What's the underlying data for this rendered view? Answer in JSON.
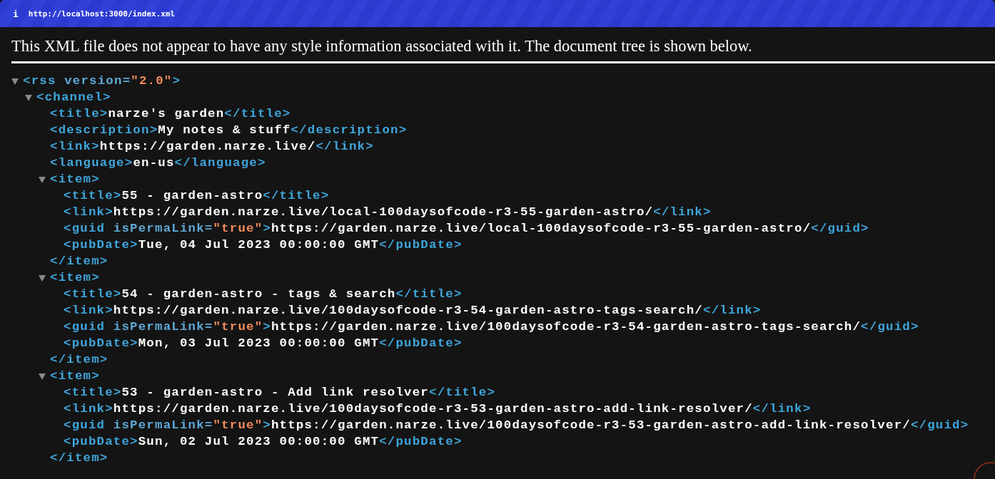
{
  "address_bar": {
    "info_glyph": "i",
    "url": "http://localhost:3000/index.xml"
  },
  "notice": "This XML file does not appear to have any style information associated with it. The document tree is shown below.",
  "tree": [
    {
      "kind": "element",
      "expanded": true,
      "open": [
        {
          "kind": "tag",
          "text": "<rss "
        },
        {
          "kind": "attr",
          "text": "version="
        },
        {
          "kind": "value",
          "text": "\"2.0\""
        },
        {
          "kind": "tag",
          "text": ">"
        }
      ],
      "children": [
        {
          "kind": "element",
          "expanded": true,
          "open": [
            {
              "kind": "tag",
              "text": "<channel>"
            }
          ],
          "children": [
            {
              "kind": "line",
              "tokens": [
                {
                  "kind": "tag",
                  "text": "<title>"
                },
                {
                  "kind": "text",
                  "text": "narze's garden"
                },
                {
                  "kind": "tag",
                  "text": "</title>"
                }
              ]
            },
            {
              "kind": "line",
              "tokens": [
                {
                  "kind": "tag",
                  "text": "<description>"
                },
                {
                  "kind": "text",
                  "text": "My notes & stuff"
                },
                {
                  "kind": "tag",
                  "text": "</description>"
                }
              ]
            },
            {
              "kind": "line",
              "tokens": [
                {
                  "kind": "tag",
                  "text": "<link>"
                },
                {
                  "kind": "text",
                  "text": "https://garden.narze.live/"
                },
                {
                  "kind": "tag",
                  "text": "</link>"
                }
              ]
            },
            {
              "kind": "line",
              "tokens": [
                {
                  "kind": "tag",
                  "text": "<language>"
                },
                {
                  "kind": "text",
                  "text": "en-us"
                },
                {
                  "kind": "tag",
                  "text": "</language>"
                }
              ]
            },
            {
              "kind": "element",
              "expanded": true,
              "open": [
                {
                  "kind": "tag",
                  "text": "<item>"
                }
              ],
              "children": [
                {
                  "kind": "line",
                  "tokens": [
                    {
                      "kind": "tag",
                      "text": "<title>"
                    },
                    {
                      "kind": "text",
                      "text": "55 - garden-astro"
                    },
                    {
                      "kind": "tag",
                      "text": "</title>"
                    }
                  ]
                },
                {
                  "kind": "line",
                  "tokens": [
                    {
                      "kind": "tag",
                      "text": "<link>"
                    },
                    {
                      "kind": "text",
                      "text": "https://garden.narze.live/local-100daysofcode-r3-55-garden-astro/"
                    },
                    {
                      "kind": "tag",
                      "text": "</link>"
                    }
                  ]
                },
                {
                  "kind": "line",
                  "tokens": [
                    {
                      "kind": "tag",
                      "text": "<guid "
                    },
                    {
                      "kind": "attr",
                      "text": "isPermaLink="
                    },
                    {
                      "kind": "value",
                      "text": "\"true\""
                    },
                    {
                      "kind": "tag",
                      "text": ">"
                    },
                    {
                      "kind": "text",
                      "text": "https://garden.narze.live/local-100daysofcode-r3-55-garden-astro/"
                    },
                    {
                      "kind": "tag",
                      "text": "</guid>"
                    }
                  ]
                },
                {
                  "kind": "line",
                  "tokens": [
                    {
                      "kind": "tag",
                      "text": "<pubDate>"
                    },
                    {
                      "kind": "text",
                      "text": "Tue, 04 Jul 2023 00:00:00 GMT"
                    },
                    {
                      "kind": "tag",
                      "text": "</pubDate>"
                    }
                  ]
                }
              ],
              "close": [
                {
                  "kind": "tag",
                  "text": "</item>"
                }
              ]
            },
            {
              "kind": "element",
              "expanded": true,
              "open": [
                {
                  "kind": "tag",
                  "text": "<item>"
                }
              ],
              "children": [
                {
                  "kind": "line",
                  "tokens": [
                    {
                      "kind": "tag",
                      "text": "<title>"
                    },
                    {
                      "kind": "text",
                      "text": "54 - garden-astro - tags & search"
                    },
                    {
                      "kind": "tag",
                      "text": "</title>"
                    }
                  ]
                },
                {
                  "kind": "line",
                  "tokens": [
                    {
                      "kind": "tag",
                      "text": "<link>"
                    },
                    {
                      "kind": "text",
                      "text": "https://garden.narze.live/100daysofcode-r3-54-garden-astro-tags-search/"
                    },
                    {
                      "kind": "tag",
                      "text": "</link>"
                    }
                  ]
                },
                {
                  "kind": "line",
                  "tokens": [
                    {
                      "kind": "tag",
                      "text": "<guid "
                    },
                    {
                      "kind": "attr",
                      "text": "isPermaLink="
                    },
                    {
                      "kind": "value",
                      "text": "\"true\""
                    },
                    {
                      "kind": "tag",
                      "text": ">"
                    },
                    {
                      "kind": "text",
                      "text": "https://garden.narze.live/100daysofcode-r3-54-garden-astro-tags-search/"
                    },
                    {
                      "kind": "tag",
                      "text": "</guid>"
                    }
                  ]
                },
                {
                  "kind": "line",
                  "tokens": [
                    {
                      "kind": "tag",
                      "text": "<pubDate>"
                    },
                    {
                      "kind": "text",
                      "text": "Mon, 03 Jul 2023 00:00:00 GMT"
                    },
                    {
                      "kind": "tag",
                      "text": "</pubDate>"
                    }
                  ]
                }
              ],
              "close": [
                {
                  "kind": "tag",
                  "text": "</item>"
                }
              ]
            },
            {
              "kind": "element",
              "expanded": true,
              "open": [
                {
                  "kind": "tag",
                  "text": "<item>"
                }
              ],
              "children": [
                {
                  "kind": "line",
                  "tokens": [
                    {
                      "kind": "tag",
                      "text": "<title>"
                    },
                    {
                      "kind": "text",
                      "text": "53 - garden-astro - Add link resolver"
                    },
                    {
                      "kind": "tag",
                      "text": "</title>"
                    }
                  ]
                },
                {
                  "kind": "line",
                  "tokens": [
                    {
                      "kind": "tag",
                      "text": "<link>"
                    },
                    {
                      "kind": "text",
                      "text": "https://garden.narze.live/100daysofcode-r3-53-garden-astro-add-link-resolver/"
                    },
                    {
                      "kind": "tag",
                      "text": "</link>"
                    }
                  ]
                },
                {
                  "kind": "line",
                  "tokens": [
                    {
                      "kind": "tag",
                      "text": "<guid "
                    },
                    {
                      "kind": "attr",
                      "text": "isPermaLink="
                    },
                    {
                      "kind": "value",
                      "text": "\"true\""
                    },
                    {
                      "kind": "tag",
                      "text": ">"
                    },
                    {
                      "kind": "text",
                      "text": "https://garden.narze.live/100daysofcode-r3-53-garden-astro-add-link-resolver/"
                    },
                    {
                      "kind": "tag",
                      "text": "</guid>"
                    }
                  ]
                },
                {
                  "kind": "line",
                  "tokens": [
                    {
                      "kind": "tag",
                      "text": "<pubDate>"
                    },
                    {
                      "kind": "text",
                      "text": "Sun, 02 Jul 2023 00:00:00 GMT"
                    },
                    {
                      "kind": "tag",
                      "text": "</pubDate>"
                    }
                  ]
                }
              ],
              "close": [
                {
                  "kind": "tag",
                  "text": "</item>"
                }
              ]
            }
          ]
        }
      ]
    }
  ]
}
